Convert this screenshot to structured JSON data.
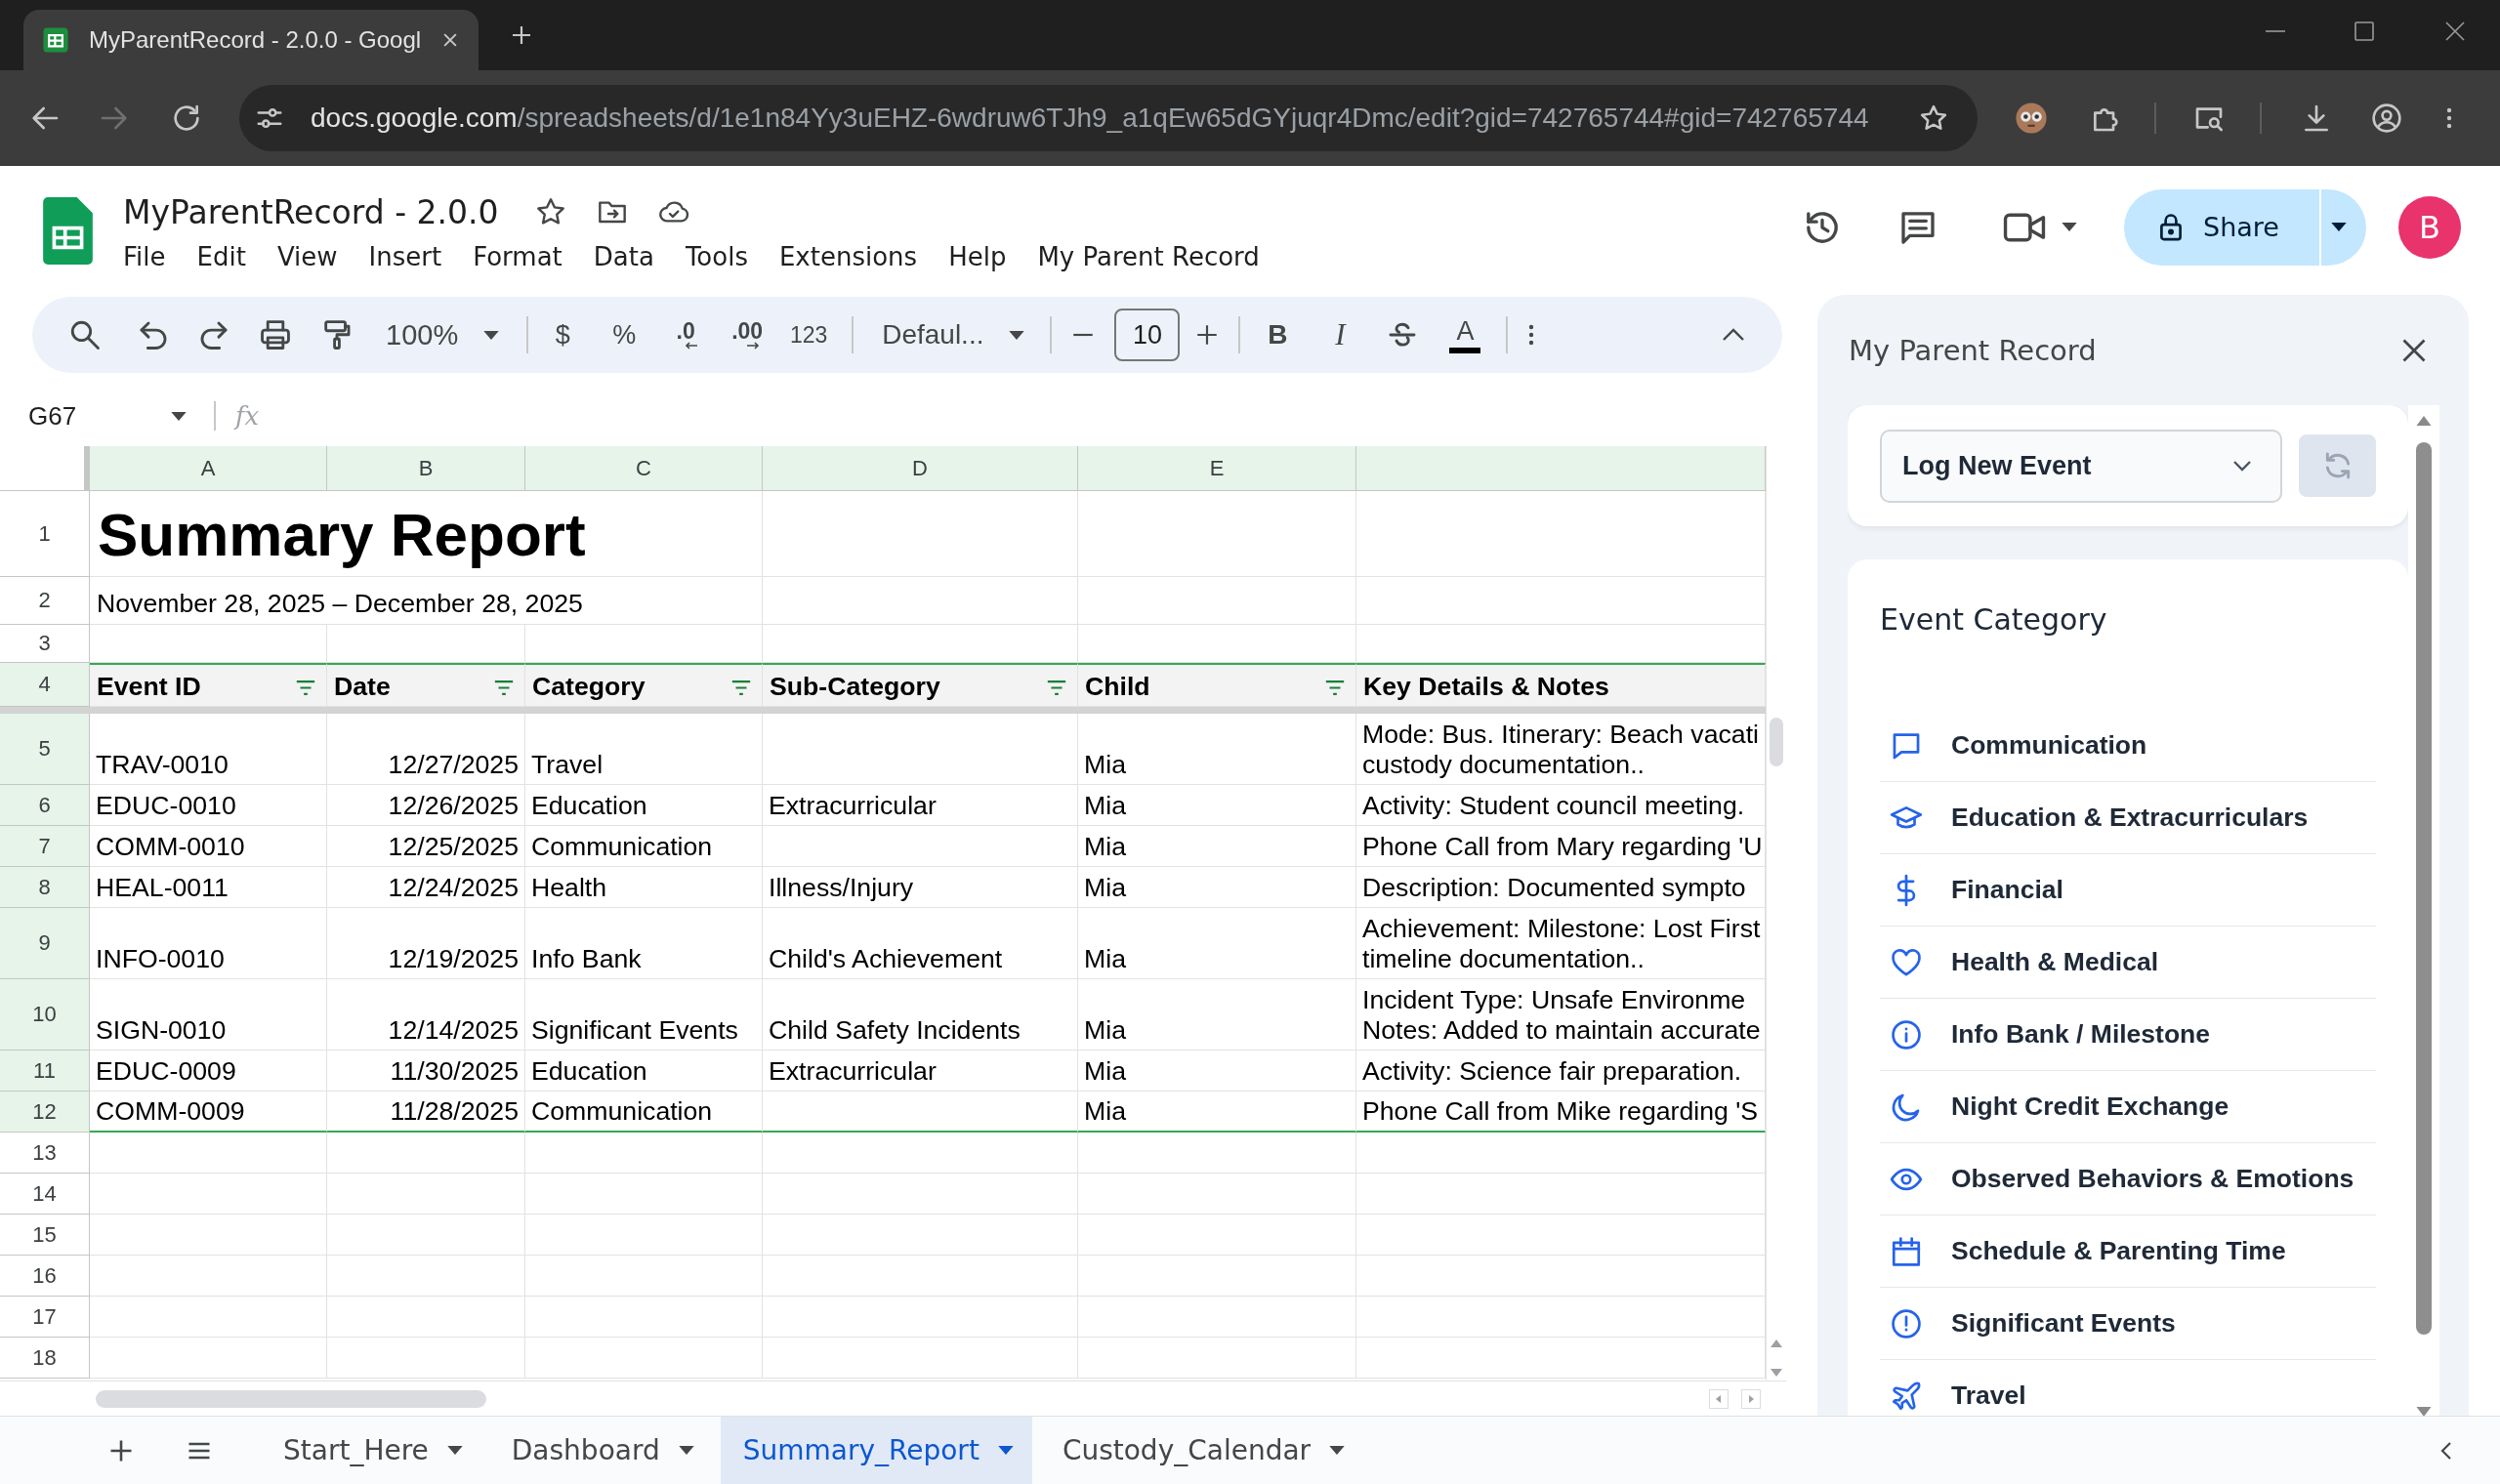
{
  "browser": {
    "tabs": [
      {
        "title": "MyParentRecord - 2.0.0 - Googl",
        "selected": true
      }
    ],
    "forward_button": {
      "disabled": true
    },
    "address_bar": {
      "host": "docs.google.com",
      "path": "/spreadsheets/d/1e1n84Yy3uEHZ-6wdruw6TJh9_a1qEw65dGYjuqr4Dmc/edit?gid=742765744#gid=742765744"
    }
  },
  "document": {
    "title": "MyParentRecord - 2.0.0",
    "menu": [
      "File",
      "Edit",
      "View",
      "Insert",
      "Format",
      "Data",
      "Tools",
      "Extensions",
      "Help",
      "My Parent Record"
    ],
    "share_button": "Share",
    "account_initial": "B"
  },
  "toolbar": {
    "zoom": "100%",
    "number_formats": [
      {
        "label": "$",
        "kind": "plain"
      },
      {
        "label": "%",
        "kind": "plain"
      },
      {
        "label": ".0",
        "kind": "decrease"
      },
      {
        "label": ".00",
        "kind": "increase"
      },
      {
        "label": "123",
        "kind": "plain"
      }
    ],
    "font": "Defaul...",
    "font_size": "10",
    "text_formats": [
      {
        "label": "B",
        "kind": "bold"
      },
      {
        "label": "I",
        "kind": "italic"
      },
      {
        "kind": "strikethrough"
      },
      {
        "label": "A",
        "kind": "text-color"
      }
    ]
  },
  "formula_bar": {
    "cell_reference": "G67",
    "function_label": "fx"
  },
  "sheet": {
    "column_letters": [
      "A",
      "B",
      "C",
      "D",
      "E"
    ],
    "row_numbers": [
      "1",
      "2",
      "3",
      "4",
      "5",
      "6",
      "7",
      "8",
      "9",
      "10",
      "11",
      "12",
      "13",
      "14",
      "15",
      "16",
      "17",
      "18"
    ],
    "title": "Summary Report",
    "date_range": "November 28, 2025 – December 28, 2025",
    "table": {
      "headers": [
        {
          "label": "Event ID",
          "filter": true
        },
        {
          "label": "Date",
          "filter": true
        },
        {
          "label": "Category",
          "filter": true
        },
        {
          "label": "Sub-Category",
          "filter": true
        },
        {
          "label": "Child",
          "filter": true
        },
        {
          "label": "Key Details & Notes",
          "filter": false
        }
      ],
      "rows": [
        {
          "event_id": "TRAV-0010",
          "date": "12/27/2025",
          "category": "Travel",
          "child": "Mia",
          "notes": [
            "Mode: Bus. Itinerary: Beach vacati",
            "custody documentation.."
          ]
        },
        {
          "event_id": "EDUC-0010",
          "date": "12/26/2025",
          "category": "Education",
          "sub_category": "Extracurricular",
          "child": "Mia",
          "notes": [
            "Activity: Student council meeting."
          ]
        },
        {
          "event_id": "COMM-0010",
          "date": "12/25/2025",
          "category": "Communication",
          "child": "Mia",
          "notes": [
            "Phone Call from Mary regarding 'U"
          ]
        },
        {
          "event_id": "HEAL-0011",
          "date": "12/24/2025",
          "category": "Health",
          "sub_category": "Illness/Injury",
          "child": "Mia",
          "notes": [
            "Description: Documented sympto"
          ]
        },
        {
          "event_id": "INFO-0010",
          "date": "12/19/2025",
          "category": "Info Bank",
          "sub_category": "Child's Achievement",
          "child": "Mia",
          "notes": [
            "Achievement: Milestone: Lost First",
            "timeline documentation.."
          ]
        },
        {
          "event_id": "SIGN-0010",
          "date": "12/14/2025",
          "category": "Significant Events",
          "sub_category": "Child Safety Incidents",
          "child": "Mia",
          "notes": [
            "Incident Type: Unsafe Environme",
            "Notes: Added to maintain accurate"
          ]
        },
        {
          "event_id": "EDUC-0009",
          "date": "11/30/2025",
          "category": "Education",
          "sub_category": "Extracurricular",
          "child": "Mia",
          "notes": [
            "Activity: Science fair preparation."
          ]
        },
        {
          "event_id": "COMM-0009",
          "date": "11/28/2025",
          "category": "Communication",
          "child": "Mia",
          "notes": [
            "Phone Call from Mike regarding 'S"
          ]
        }
      ]
    }
  },
  "sheet_tabs": [
    {
      "label": "Start_Here",
      "selected": false
    },
    {
      "label": "Dashboard",
      "selected": false
    },
    {
      "label": "Summary_Report",
      "selected": true
    },
    {
      "label": "Custody_Calendar",
      "selected": false
    }
  ],
  "side_panel": {
    "title": "My Parent Record",
    "event_select": "Log New Event",
    "section_title": "Event Category",
    "categories": [
      "Communication",
      "Education & Extracurriculars",
      "Financial",
      "Health & Medical",
      "Info Bank / Milestone",
      "Night Credit Exchange",
      "Observed Behaviors & Emotions",
      "Schedule & Parenting Time",
      "Significant Events",
      "Travel"
    ]
  }
}
